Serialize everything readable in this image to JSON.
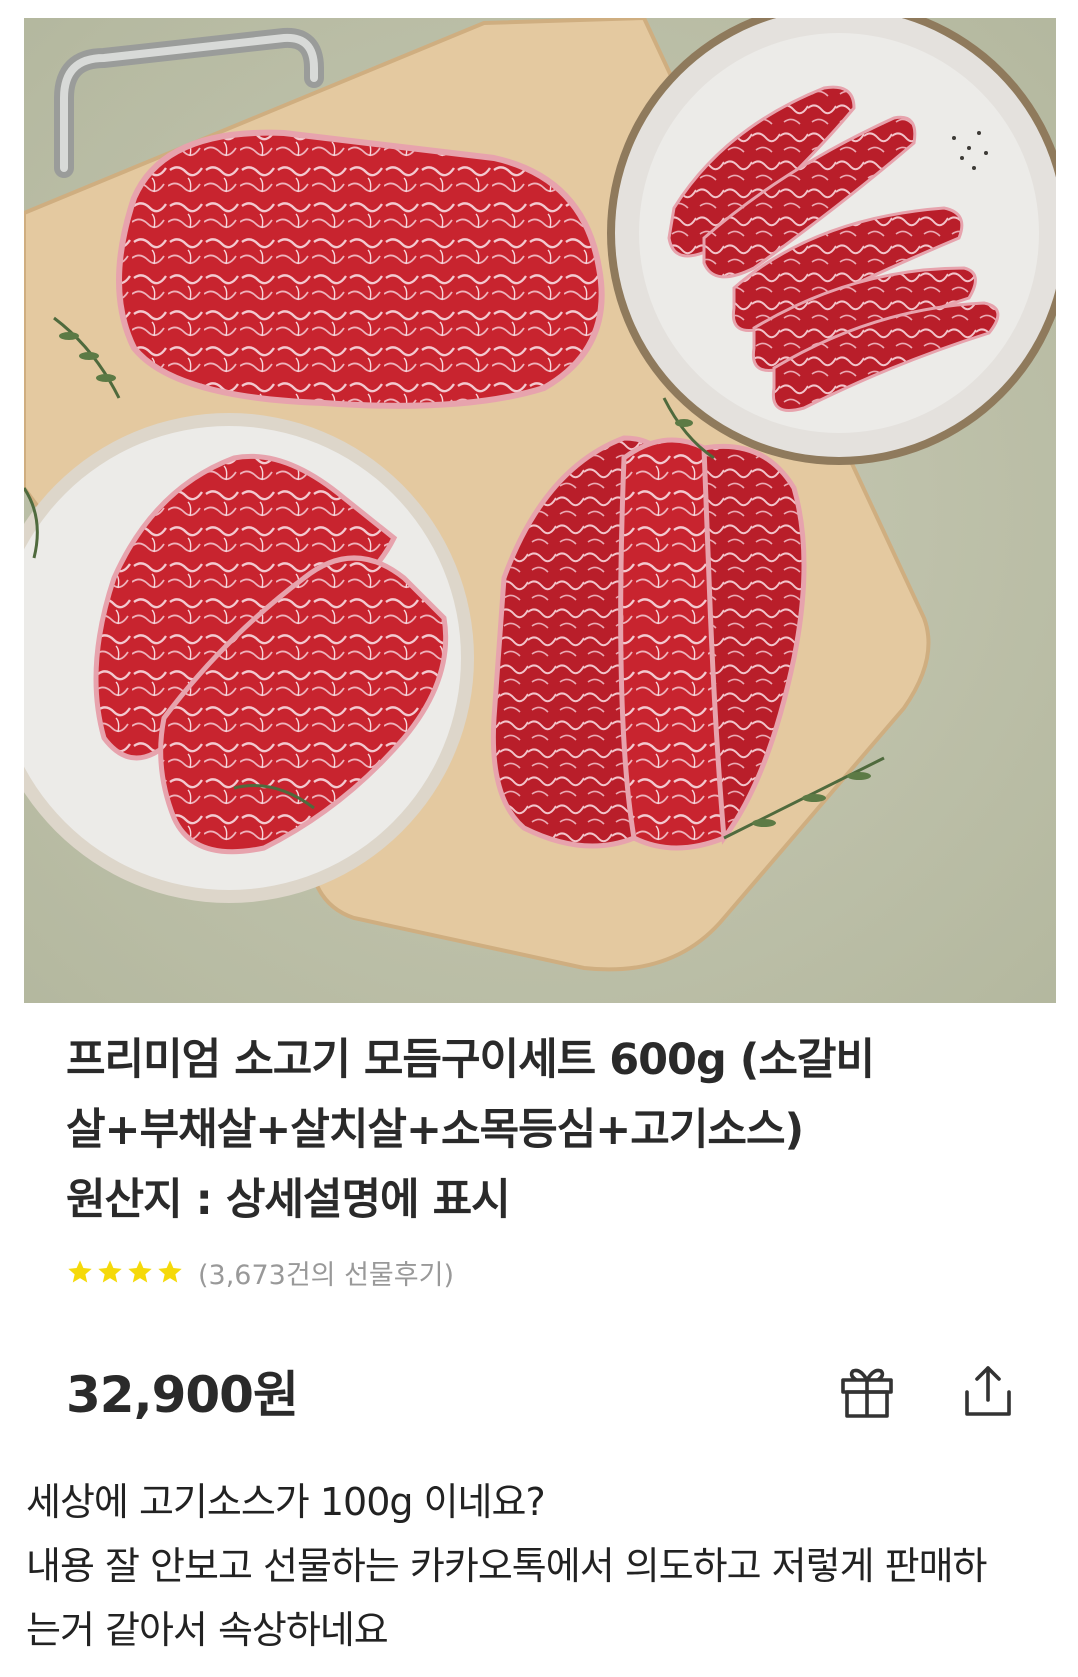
{
  "product": {
    "title_line1": "프리미엄 소고기 모듬구이세트 600g (소갈비",
    "title_line2": "살+부채살+살치살+소목등심+고기소스)",
    "origin": "원산지 : 상세설명에 표시",
    "rating_stars": 4,
    "reviews": "(3,673건의 선물후기)",
    "price": "32,900원",
    "accent_star_color": "#f5d90a"
  },
  "actions": {
    "gift_icon": "gift-icon",
    "share_icon": "share-icon"
  },
  "comment": {
    "line1": "세상에 고기소스가 100g 이네요?",
    "line2": "내용 잘 안보고 선물하는 카카오톡에서 의도하고 저렇게 판매하",
    "line3": "는거 같아서 속상하네요"
  }
}
